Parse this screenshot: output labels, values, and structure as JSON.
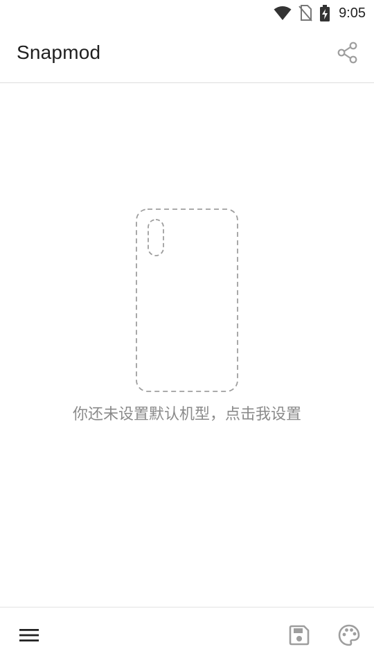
{
  "status_bar": {
    "time": "9:05",
    "icons": [
      "wifi-icon",
      "no-sim-icon",
      "battery-charging-icon"
    ]
  },
  "app_bar": {
    "title": "Snapmod",
    "share_icon": "share-icon"
  },
  "main": {
    "placeholder_icon": "phone-outline-icon",
    "hint": "你还未设置默认机型，点击我设置"
  },
  "bottom_bar": {
    "menu_icon": "menu-icon",
    "save_icon": "save-icon",
    "palette_icon": "palette-icon"
  },
  "colors": {
    "text_primary": "#1f1f1f",
    "text_secondary": "#8a8a8a",
    "icon_gray": "#9e9e9e",
    "divider": "#dcdcdc",
    "background": "#ffffff"
  }
}
